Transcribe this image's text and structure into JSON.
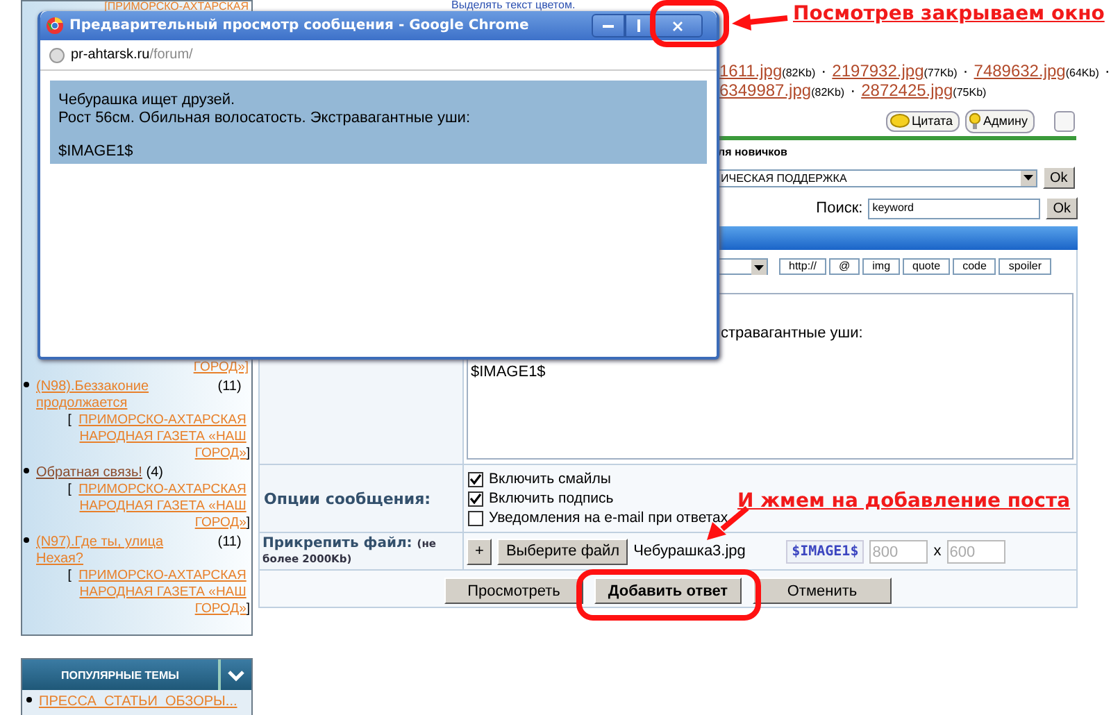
{
  "preview_window": {
    "title": "Предварительный просмотр сообщения - Google Chrome",
    "url_host": "pr-ahtarsk.ru",
    "url_path": "/forum/",
    "message_lines": [
      "Чебурашка ищет друзей.",
      "Рост 56см. Обильная волосатость. Экстравагантные уши:",
      "$IMAGE1$"
    ]
  },
  "sidebar": {
    "top_fragment": "[ПРИМОРСКО-АХТАРСКАЯ",
    "tail_fragment": "ГОРОД»]",
    "topics": [
      {
        "title": "(N98).Беззаконие продолжается",
        "count": "(11)",
        "source_open": "[",
        "source": "ПРИМОРСКО-АХТАРСКАЯ НАРОДНАЯ ГАЗЕТА «НАШ ГОРОД»",
        "source_close": "]"
      },
      {
        "title": "Обратная связь!",
        "count": "(4)",
        "source_open": "[",
        "source": "ПРИМОРСКО-АХТАРСКАЯ НАРОДНАЯ ГАЗЕТА «НАШ ГОРОД»",
        "source_close": "]"
      },
      {
        "title": "(N97).Где ты, улица Нехая?",
        "count": "(11)",
        "source_open": "[",
        "source": "ПРИМОРСКО-АХТАРСКАЯ НАРОДНАЯ ГАЗЕТА «НАШ ГОРОД»",
        "source_close": "]"
      }
    ]
  },
  "popular_topics": {
    "title": "ПОПУЛЯРНЫЕ ТЕМЫ",
    "items": [
      "ПРЕССА_СТАТЬИ_ОБЗОРЫ..."
    ]
  },
  "post": {
    "highlight_hint": "Выделять текст цветом.",
    "attachments": [
      [
        {
          "name": "1611.jpg",
          "size": "(82Kb)",
          "after": "·"
        },
        {
          "name": "2197932.jpg",
          "size": "(77Kb)",
          "after": "·"
        },
        {
          "name": "7489632.jpg",
          "size": "(64Kb)",
          "after": "·"
        }
      ],
      [
        {
          "name": "6349987.jpg",
          "size": "(82Kb)",
          "after": "·"
        },
        {
          "name": "2872425.jpg",
          "size": "(75Kb)"
        }
      ]
    ],
    "post_buttons": [
      "Цитата",
      "Админу"
    ],
    "forum_label": "ля новичков",
    "forum_select": "ИЧЕСКАЯ ПОДДЕРЖКА",
    "go_button": "Ok",
    "search_label": "Поиск:",
    "search_value": "keyword",
    "search_button": "Ok",
    "format_buttons": [
      "http://",
      "@",
      "img",
      "quote",
      "code",
      "spoiler"
    ],
    "message_lines": [
      "стравагантные уши:",
      "$IMAGE1$"
    ],
    "options_label": "Опции сообщения:",
    "options": [
      {
        "label": "Включить смайлы",
        "checked": true
      },
      {
        "label": "Включить подпись",
        "checked": true
      },
      {
        "label": "Уведомления на e-mail при ответах",
        "checked": false
      }
    ],
    "attach_label": "Прикрепить файл:",
    "attach_limit": "(не более 2000Kb)",
    "add_button": "+",
    "choose_button": "Выберите файл",
    "file_name": "Чебурашка3.jpg",
    "image_tag": "$IMAGE1$",
    "width_value": "800",
    "times": "x",
    "height_value": "600",
    "actions": [
      {
        "label": "Просмотреть",
        "primary": false
      },
      {
        "label": "Добавить ответ",
        "primary": true
      },
      {
        "label": "Отменить",
        "primary": false
      }
    ]
  },
  "annotations": [
    {
      "text": "Посмотрев закрываем окно"
    },
    {
      "text": "И жмем на добавление поста"
    }
  ]
}
